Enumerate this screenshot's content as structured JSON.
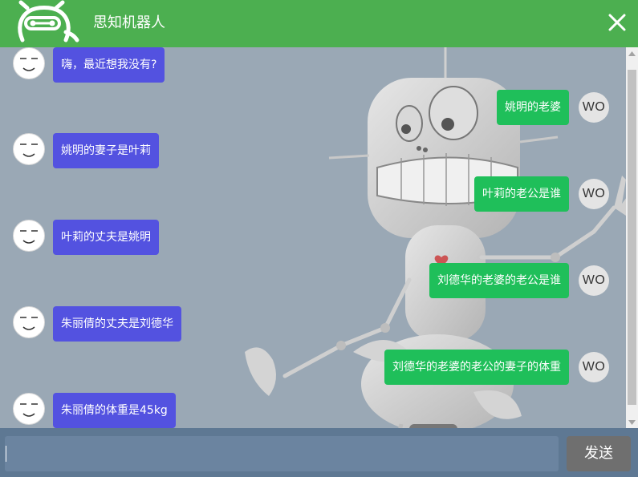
{
  "header": {
    "title": "思知机器人",
    "logo_icon": "robot-logo-icon",
    "close_icon": "close-icon"
  },
  "colors": {
    "header": "#4caf50",
    "bot_bubble": "#5352e0",
    "user_bubble": "#1fbf5a",
    "input_bar": "#5e7893",
    "send_button": "#6f6f6f"
  },
  "bot_messages": [
    {
      "text": "嗨，最近想我没有?"
    },
    {
      "text": "姚明的妻子是叶莉"
    },
    {
      "text": "叶莉的丈夫是姚明"
    },
    {
      "text": "朱丽倩的丈夫是刘德华"
    },
    {
      "text": "朱丽倩的体重是45kg"
    }
  ],
  "user_messages": [
    {
      "text": "姚明的老婆",
      "avatar": "WO"
    },
    {
      "text": "叶莉的老公是谁",
      "avatar": "WO"
    },
    {
      "text": "刘德华的老婆的老公是谁",
      "avatar": "WO"
    },
    {
      "text": "刘德华的老婆的老公的妻子的体重",
      "avatar": "WO"
    }
  ],
  "input": {
    "value": "",
    "placeholder": ""
  },
  "send_label": "发送"
}
